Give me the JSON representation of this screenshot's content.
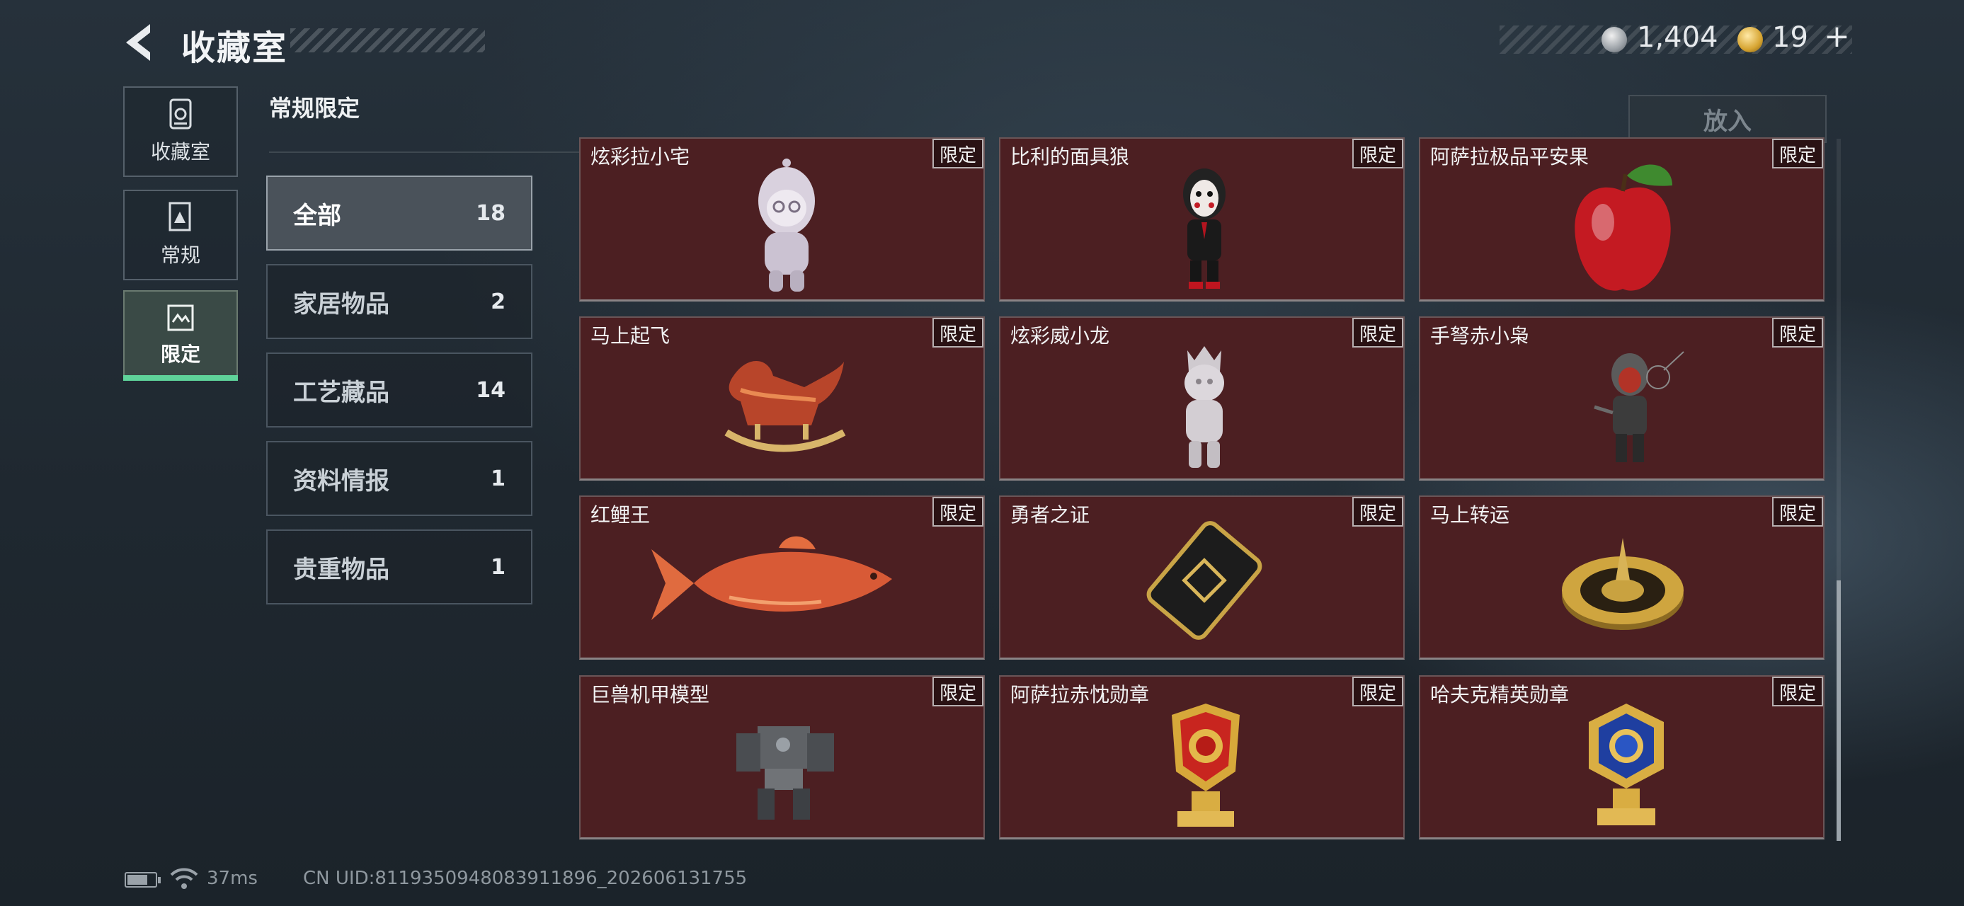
{
  "header": {
    "title": "收藏室",
    "currency": {
      "silver": "1,404",
      "gold": "19",
      "gold_add": "+"
    }
  },
  "nav": [
    {
      "label": "收藏室",
      "icon": "vault-icon"
    },
    {
      "label": "常规",
      "icon": "document-icon"
    },
    {
      "label": "限定",
      "icon": "limited-icon",
      "active": true
    }
  ],
  "section": {
    "title": "常规限定",
    "categories": [
      {
        "label": "全部",
        "count": "18",
        "active": true
      },
      {
        "label": "家居物品",
        "count": "2"
      },
      {
        "label": "工艺藏品",
        "count": "14"
      },
      {
        "label": "资料情报",
        "count": "1"
      },
      {
        "label": "贵重物品",
        "count": "1"
      }
    ]
  },
  "put_in_label": "放入",
  "items": [
    {
      "name": "炫彩拉小宅",
      "badge": "限定",
      "icon": "plush-figure-icon"
    },
    {
      "name": "比利的面具狼",
      "badge": "限定",
      "icon": "masked-figure-icon"
    },
    {
      "name": "阿萨拉极品平安果",
      "badge": "限定",
      "icon": "apple-icon"
    },
    {
      "name": "马上起飞",
      "badge": "限定",
      "icon": "rocking-horse-icon"
    },
    {
      "name": "炫彩威小龙",
      "badge": "限定",
      "icon": "dragon-figure-icon"
    },
    {
      "name": "手弩赤小枭",
      "badge": "限定",
      "icon": "crossbow-figure-icon"
    },
    {
      "name": "红鲤王",
      "badge": "限定",
      "icon": "carp-icon"
    },
    {
      "name": "勇者之证",
      "badge": "限定",
      "icon": "card-icon"
    },
    {
      "name": "马上转运",
      "badge": "限定",
      "icon": "roulette-icon"
    },
    {
      "name": "巨兽机甲模型",
      "badge": "限定",
      "icon": "mech-model-icon"
    },
    {
      "name": "阿萨拉赤忱勋章",
      "badge": "限定",
      "icon": "medal-red-icon"
    },
    {
      "name": "哈夫克精英勋章",
      "badge": "限定",
      "icon": "medal-blue-icon"
    }
  ],
  "status": {
    "ping": "37ms",
    "uid": "CN UID:8119350948083911896_202606131755"
  }
}
